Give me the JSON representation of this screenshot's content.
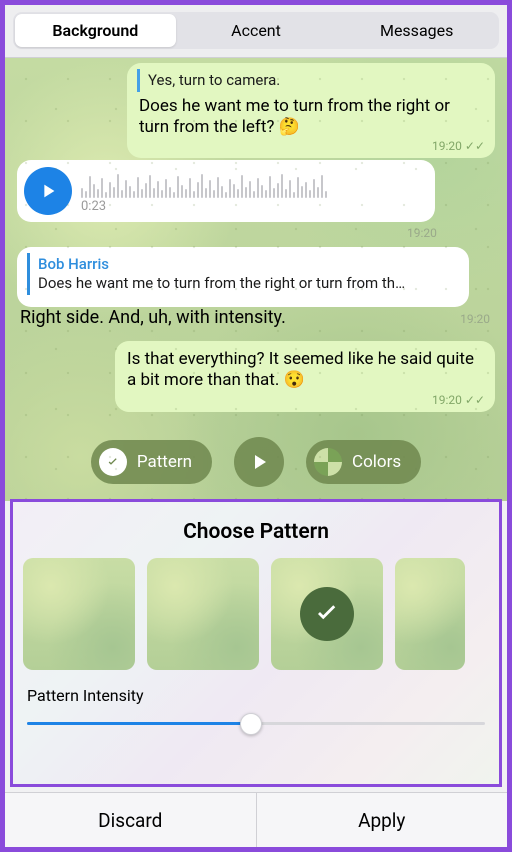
{
  "tabs": {
    "background": "Background",
    "accent": "Accent",
    "messages": "Messages",
    "active": "Background"
  },
  "chat": {
    "reply_line_1": "Yes, turn to camera.",
    "msg1": "Does he want me to turn from the right or turn from the left? 🤔",
    "msg1_time": "19:20",
    "voice_duration": "0:23",
    "voice_time": "19:20",
    "fwd_name": "Bob Harris",
    "fwd_text": "Does he want me to turn from the right or turn from th…",
    "plain_text": "Right side. And, uh, with intensity.",
    "plain_time": "19:20",
    "msg2": "Is that everything? It seemed like he said quite a bit more than that. 😯",
    "msg2_time": "19:20"
  },
  "pills": {
    "pattern": "Pattern",
    "colors": "Colors"
  },
  "panel": {
    "title": "Choose Pattern",
    "intensity_label": "Pattern Intensity",
    "intensity_value": 0.49,
    "selected_index": 2,
    "thumb_count": 4
  },
  "actions": {
    "discard": "Discard",
    "apply": "Apply"
  },
  "colors": {
    "accent_blue": "#1d83e6"
  }
}
